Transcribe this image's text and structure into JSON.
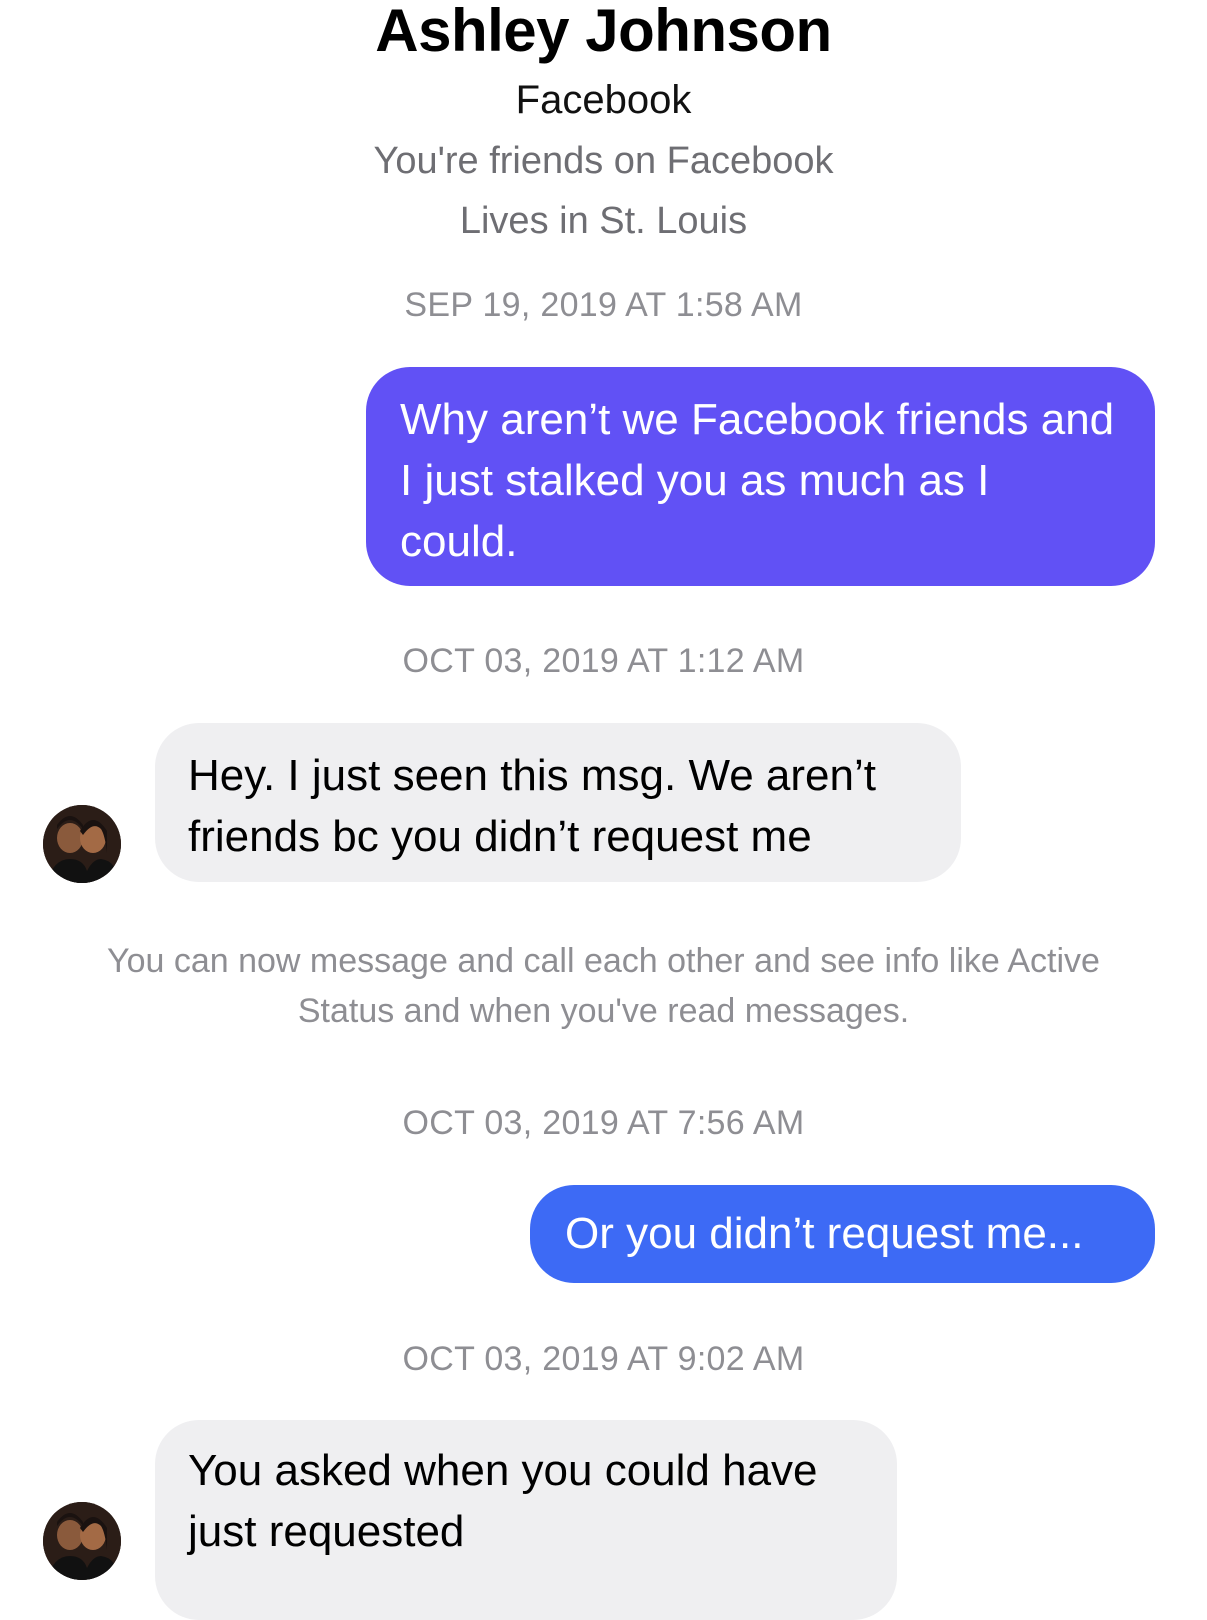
{
  "contact": {
    "name": "Ashley Johnson",
    "source": "Facebook",
    "friend_status": "You're friends on Facebook",
    "location": "Lives in St. Louis"
  },
  "conversation": {
    "timestamps": [
      "SEP 19, 2019 AT 1:58 AM",
      "OCT 03, 2019 AT 1:12 AM",
      "OCT 03, 2019 AT 7:56 AM",
      "OCT 03, 2019 AT 9:02 AM"
    ],
    "messages": [
      {
        "sender": "me",
        "text": "Why aren’t we Facebook friends and I just stalked you as much as I could."
      },
      {
        "sender": "Ashley Johnson",
        "text": "Hey. I just seen this msg. We aren’t friends bc you didn’t request me"
      },
      {
        "sender": "me",
        "text": "Or you didn’t request me..."
      },
      {
        "sender": "Ashley Johnson",
        "text": "You asked when you could have just requested"
      }
    ],
    "system_note": "You can now message and call each other and see info like Active Status and when you've read messages."
  },
  "colors": {
    "outgoing_bubble_first": "#6151f5",
    "outgoing_bubble_second": "#3d6af5",
    "incoming_bubble": "#efeff1",
    "secondary_text": "#8e8e93"
  },
  "icons": {
    "avatar": "contact-photo-avatar"
  }
}
